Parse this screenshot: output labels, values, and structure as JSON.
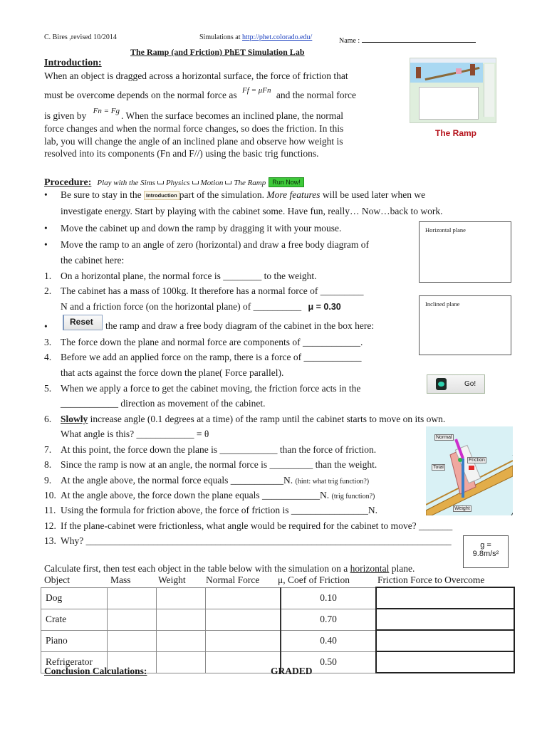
{
  "header": {
    "author": "C. Bires ,revised 10/2014",
    "simulations_prefix": "Simulations at ",
    "simulations_link": "http://phet.colorado.edu/",
    "name_label": "Name :"
  },
  "title": "The Ramp (and Friction) PhET Simulation Lab",
  "introduction": {
    "heading": "Introduction:",
    "line1": "When an object is dragged across a horizontal surface, the force of friction that",
    "line2a": "must be overcome depends on the normal force as",
    "formula1": "Ff = μFn",
    "line2b": "and the normal force",
    "line3a": "is given by",
    "formula2": "Fn = Fg",
    "line3b": ". When the surface becomes an inclined plane, the normal",
    "line4": "force changes and when the normal force changes, so does the friction.  In this",
    "line5": "lab, you will change the angle of an inclined plane and observe how weight is",
    "line6": "resolved into its components (Fn and F//) using the basic trig functions.",
    "thumbnail_caption": "The Ramp"
  },
  "procedure": {
    "heading": "Procedure:",
    "path": [
      "Play with the Sims",
      "Physics",
      "Motion",
      "The Ramp"
    ],
    "run_now": "Run Now!",
    "bullet1a": "Be sure to stay in the",
    "intro_tab": "Introduction",
    "bullet1b": "part of the simulation.",
    "bullet1c": "More features",
    "bullet1d": "will be used later when we",
    "bullet1e": "investigate energy.  Start by playing with the cabinet some.  Have fun, really…    Now…back to work.",
    "bullet2": "Move the cabinet up and down the ramp by dragging it with your mouse.",
    "bullet3a": "Move the ramp to an angle of zero (horizontal) and draw a free body diagram of",
    "bullet3b": "the cabinet here:",
    "q1": "On a horizontal plane, the normal force is ________ to the weight.",
    "q2a": "The cabinet has a mass of 100kg.  It therefore has a normal force of _________",
    "q2b": "N and a friction force (on the horizontal plane) of __________",
    "mu": "μ = 0.30",
    "reset_button": "Reset",
    "bullet4": "the ramp and draw a free body diagram of the cabinet in the box here:",
    "q3": "The force down the plane and normal force are components of ____________.",
    "q4a": "Before we add an applied force on the ramp, there is a force of ____________",
    "q4b": "that acts against the force down the plane( Force parallel).",
    "q5a": "When we apply a force to get the cabinet moving, the friction force acts in the",
    "q5b": "____________ direction as movement of the cabinet.",
    "q6a_bold": "Slowly",
    "q6a": " increase angle (0.1 degrees at a time) of the ramp until the cabinet starts to move on its own.",
    "q6b": "What angle is this? ____________ = θ",
    "q7": "At this point, the force down the plane is ____________ than the force of friction.",
    "q8": "Since the ramp is now at an angle, the normal force is _________ than the weight.",
    "q9": "At the angle above, the normal force equals ___________N.",
    "q9_hint": "(hint: what trig function?)",
    "q10": "At the angle above, the force down the plane equals ____________N.",
    "q10_hint": "(trig function?)",
    "q11": "Using the formula for friction above, the force of friction is ________________N.",
    "q12": "If the plane-cabinet were frictionless, what angle would be required for the cabinet to move?  _______",
    "q13": "Why? ____________________________________________________________________________",
    "numbers": [
      "1.",
      "2.",
      "3.",
      "4.",
      "5.",
      "6.",
      "7.",
      "8.",
      "9.",
      "10.",
      "11.",
      "12.",
      "13."
    ],
    "go_button": "Go!",
    "box_horizontal": "Horizontal plane",
    "box_inclined": "Inclined plane",
    "diagram_labels": {
      "normal": "Normal",
      "friction": "Friction",
      "total": "Total",
      "weight": "Weight"
    }
  },
  "gravity_box": {
    "line1": "g =",
    "line2": "9.8m/s²"
  },
  "table_intro": {
    "a": "Calculate first, then test each object in the table below with the simulation on a ",
    "u": "horizontal",
    "b": " plane."
  },
  "table": {
    "headers": [
      "Object",
      "Mass",
      "Weight",
      "Normal Force",
      "μ, Coef of Friction",
      "Friction Force to Overcome"
    ],
    "rows": [
      {
        "object": "Dog",
        "mass": "",
        "weight": "",
        "normal": "",
        "mu": "0.10",
        "friction": ""
      },
      {
        "object": "Crate",
        "mass": "",
        "weight": "",
        "normal": "",
        "mu": "0.70",
        "friction": ""
      },
      {
        "object": "Piano",
        "mass": "",
        "weight": "",
        "normal": "",
        "mu": "0.40",
        "friction": ""
      },
      {
        "object": "Refrigerator",
        "mass": "",
        "weight": "",
        "normal": "",
        "mu": "0.50",
        "friction": ""
      }
    ]
  },
  "footer": {
    "conclusion": "Conclusion Calculations:",
    "graded": "GRADED"
  },
  "colors": {
    "run_now": "#3ec93a",
    "link": "#1a3fbf",
    "caption": "#b5121b"
  }
}
